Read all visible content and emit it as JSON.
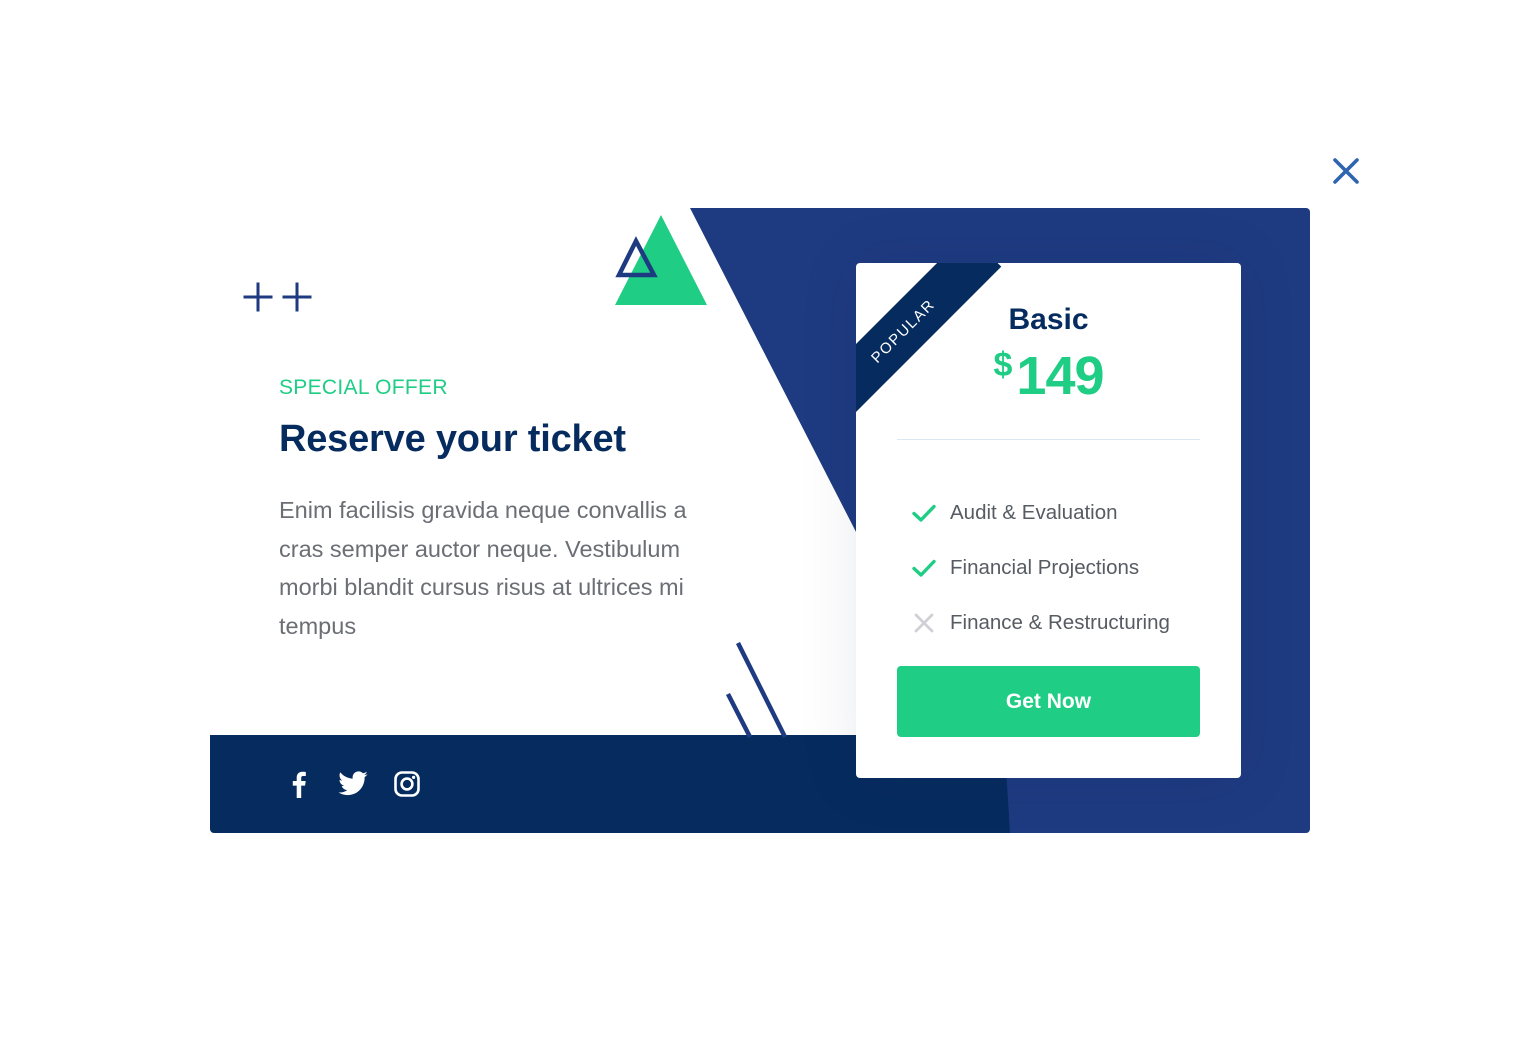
{
  "offer": {
    "eyebrow": "SPECIAL OFFER",
    "headline": "Reserve your ticket",
    "body": "Enim facilisis gravida neque convallis a cras semper auctor neque. Vestibulum morbi blandit cursus risus at ultrices mi tempus"
  },
  "plan": {
    "badge": "POPULAR",
    "name": "Basic",
    "currency": "$",
    "price": "149",
    "features": [
      {
        "label": "Audit & Evaluation",
        "included": true
      },
      {
        "label": "Financial Projections",
        "included": true
      },
      {
        "label": "Finance & Restructuring",
        "included": false
      }
    ],
    "cta_label": "Get Now"
  },
  "social_links": [
    "facebook-icon",
    "twitter-icon",
    "instagram-icon"
  ],
  "icons": {
    "close": "close-icon",
    "included": "check-icon",
    "excluded": "x-icon"
  },
  "colors": {
    "navy": "#062b5e",
    "blue": "#1e3a80",
    "green": "#1fcd84",
    "text_gray": "#6b6e74",
    "close_blue": "#2e64b0"
  }
}
